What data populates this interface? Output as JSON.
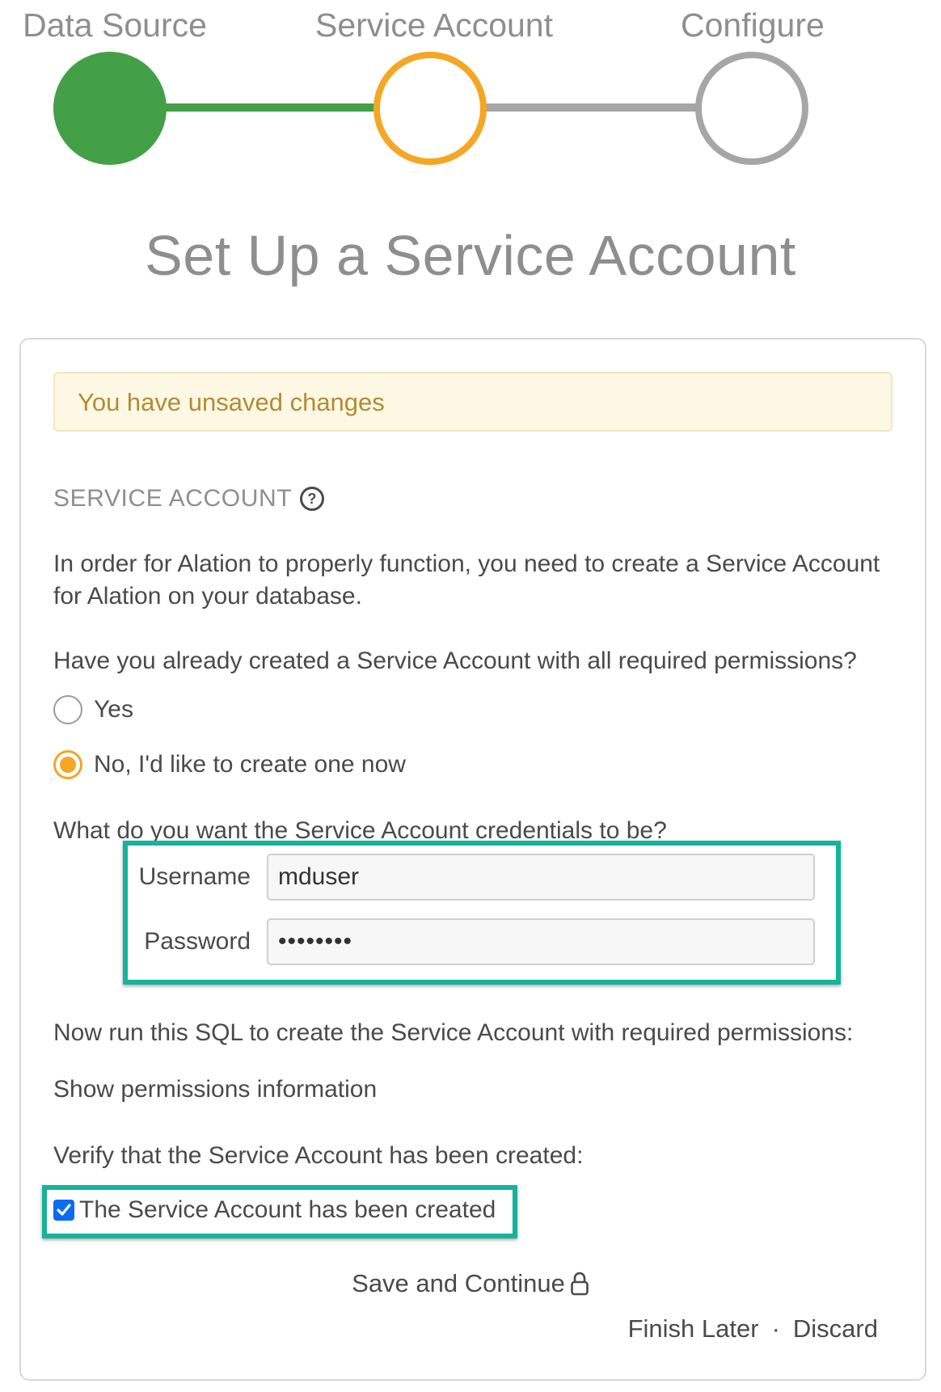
{
  "stepper": {
    "steps": [
      {
        "label": "Data Source",
        "state": "complete",
        "color": "#43a047"
      },
      {
        "label": "Service Account",
        "state": "current",
        "color": "#f5a623"
      },
      {
        "label": "Configure",
        "state": "pending",
        "color": "#a6a6a6"
      }
    ]
  },
  "page_title": "Set Up a Service Account",
  "alert": {
    "text": "You have unsaved changes"
  },
  "section": {
    "title": "SERVICE ACCOUNT",
    "help_icon": "question-circle-icon",
    "intro_line1": "In order for Alation to properly function, you need to create a Service Account",
    "intro_line2": "for Alation on your database.",
    "question": "Have you already created a Service Account with all required permissions?",
    "options": [
      {
        "label": "Yes",
        "selected": false
      },
      {
        "label": "No, I'd like to create one now",
        "selected": true
      }
    ],
    "credentials_prompt": "What do you want the Service Account credentials to be?",
    "username_label": "Username",
    "username_value": "mduser",
    "password_label": "Password",
    "password_value": "••••••••",
    "sql_prompt": "Now run this SQL to create the Service Account with required permissions:",
    "show_permissions": "Show permissions information",
    "verify_prompt": "Verify that the Service Account has been created:",
    "checkbox_label": "The Service Account has been created",
    "checkbox_checked": true
  },
  "actions": {
    "save_continue": "Save and Continue",
    "save_icon": "lock-icon",
    "finish_later": "Finish Later",
    "separator": "·",
    "discard": "Discard"
  },
  "colors": {
    "accent_highlight": "#16b39b",
    "complete": "#43a047",
    "current": "#f5a623",
    "pending": "#a6a6a6",
    "alert_bg": "#fcf8e3",
    "alert_text": "#b38b34"
  }
}
